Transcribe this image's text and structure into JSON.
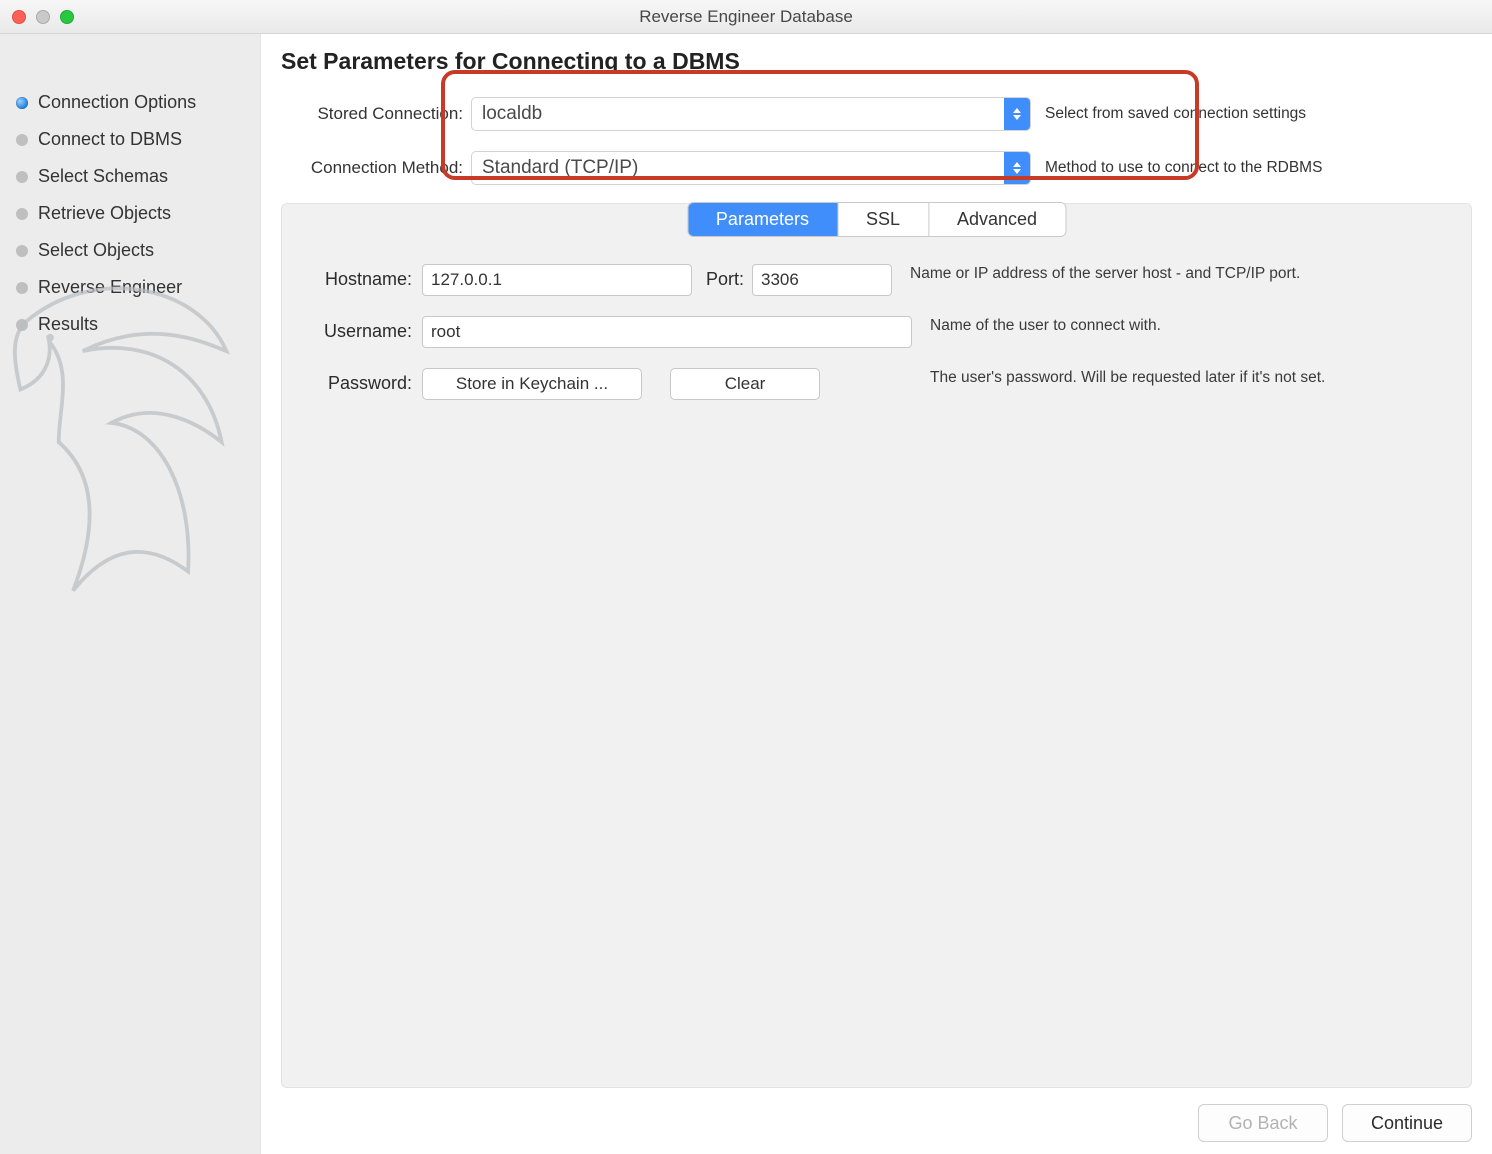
{
  "window": {
    "title": "Reverse Engineer Database"
  },
  "sidebar": {
    "items": [
      {
        "label": "Connection Options",
        "active": true
      },
      {
        "label": "Connect to DBMS",
        "active": false
      },
      {
        "label": "Select Schemas",
        "active": false
      },
      {
        "label": "Retrieve Objects",
        "active": false
      },
      {
        "label": "Select Objects",
        "active": false
      },
      {
        "label": "Reverse Engineer",
        "active": false
      },
      {
        "label": "Results",
        "active": false
      }
    ]
  },
  "main": {
    "heading": "Set Parameters for Connecting to a DBMS",
    "stored_connection": {
      "label": "Stored Connection:",
      "value": "localdb",
      "hint": "Select from saved connection settings"
    },
    "connection_method": {
      "label": "Connection Method:",
      "value": "Standard (TCP/IP)",
      "hint": "Method to use to connect to the RDBMS"
    },
    "tabs": {
      "parameters": "Parameters",
      "ssl": "SSL",
      "advanced": "Advanced"
    },
    "params": {
      "hostname": {
        "label": "Hostname:",
        "value": "127.0.0.1"
      },
      "port": {
        "label": "Port:",
        "value": "3306"
      },
      "host_hint": "Name or IP address of the server host - and TCP/IP port.",
      "username": {
        "label": "Username:",
        "value": "root",
        "hint": "Name of the user to connect with."
      },
      "password": {
        "label": "Password:",
        "store_btn": "Store in Keychain ...",
        "clear_btn": "Clear",
        "hint": "The user's password. Will be requested later if it's not set."
      }
    },
    "footer": {
      "back": "Go Back",
      "continue": "Continue"
    }
  }
}
